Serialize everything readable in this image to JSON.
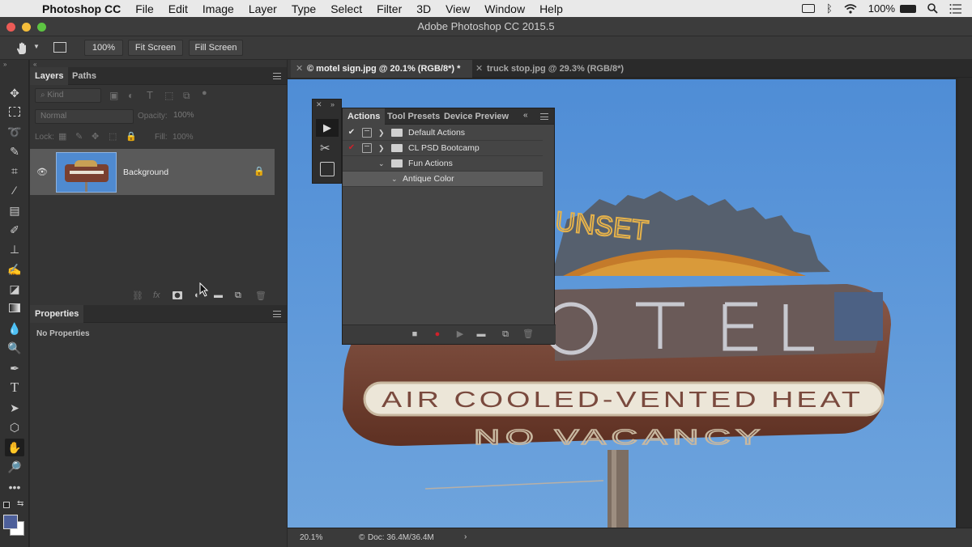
{
  "menubar": {
    "app_name": "Photoshop CC",
    "items": [
      "File",
      "Edit",
      "Image",
      "Layer",
      "Type",
      "Select",
      "Filter",
      "3D",
      "View",
      "Window",
      "Help"
    ],
    "battery": "100%"
  },
  "window": {
    "title": "Adobe Photoshop CC 2015.5"
  },
  "options_bar": {
    "zoom": "100%",
    "fit_screen": "Fit Screen",
    "fill_screen": "Fill Screen"
  },
  "layers_panel": {
    "tabs": [
      "Layers",
      "Paths"
    ],
    "kind_placeholder": "Kind",
    "blend_mode": "Normal",
    "opacity_label": "Opacity:",
    "opacity_value": "100%",
    "lock_label": "Lock:",
    "fill_label": "Fill:",
    "fill_value": "100%",
    "layers": [
      {
        "name": "Background",
        "locked": true,
        "visible": true
      }
    ]
  },
  "properties_panel": {
    "title": "Properties",
    "body": "No Properties"
  },
  "document_tabs": [
    {
      "label": "© motel sign.jpg @ 20.1% (RGB/8*) *",
      "active": true
    },
    {
      "label": "truck stop.jpg @ 29.3% (RGB/8*)",
      "active": false
    }
  ],
  "actions_panel": {
    "tabs": [
      "Actions",
      "Tool Presets",
      "Device Preview"
    ],
    "rows": [
      {
        "label": "Default Actions",
        "type": "set",
        "checked": true
      },
      {
        "label": "CL PSD Bootcamp",
        "type": "set",
        "checked": true,
        "check_color": "#c0292b"
      },
      {
        "label": "Fun Actions",
        "type": "set",
        "expanded": true
      },
      {
        "label": "Antique Color",
        "type": "action",
        "selected": true
      }
    ]
  },
  "status_bar": {
    "zoom": "20.1%",
    "doc_info": "Doc: 36.4M/36.4M"
  },
  "colors": {
    "sky": "#5f95d3",
    "record_red": "#d0202a",
    "foreground": "#4d5f9a",
    "background": "#ffffff"
  }
}
